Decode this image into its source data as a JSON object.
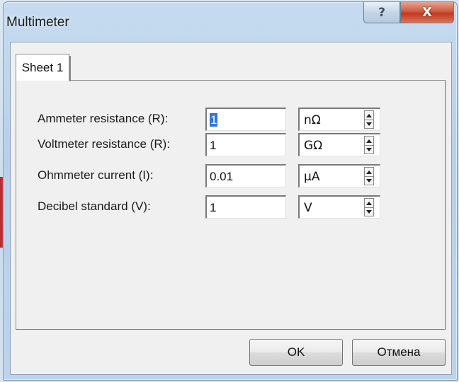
{
  "window": {
    "title": "Multimeter",
    "help_glyph": "?",
    "close_glyph": "X"
  },
  "tabs": [
    {
      "label": "Sheet 1",
      "selected": true
    }
  ],
  "fields": [
    {
      "label": "Ammeter resistance (R):",
      "value": "1",
      "unit": "nΩ",
      "value_selected": true
    },
    {
      "label": "Voltmeter resistance (R):",
      "value": "1",
      "unit": "GΩ",
      "value_selected": false
    },
    {
      "label": "Ohmmeter current (I):",
      "value": "0.01",
      "unit": "µA",
      "value_selected": false
    },
    {
      "label": "Decibel standard (V):",
      "value": "1",
      "unit": "V",
      "value_selected": false
    }
  ],
  "buttons": {
    "ok_label": "OK",
    "cancel_label": "Отмена"
  },
  "colors": {
    "selection": "#3375d7",
    "close_button": "#c13a20",
    "dialog_background": "#f0f0f0"
  },
  "icons": {
    "help": "help-icon",
    "close": "close-icon",
    "spin_up": "spin-up-icon",
    "spin_down": "spin-down-icon"
  }
}
